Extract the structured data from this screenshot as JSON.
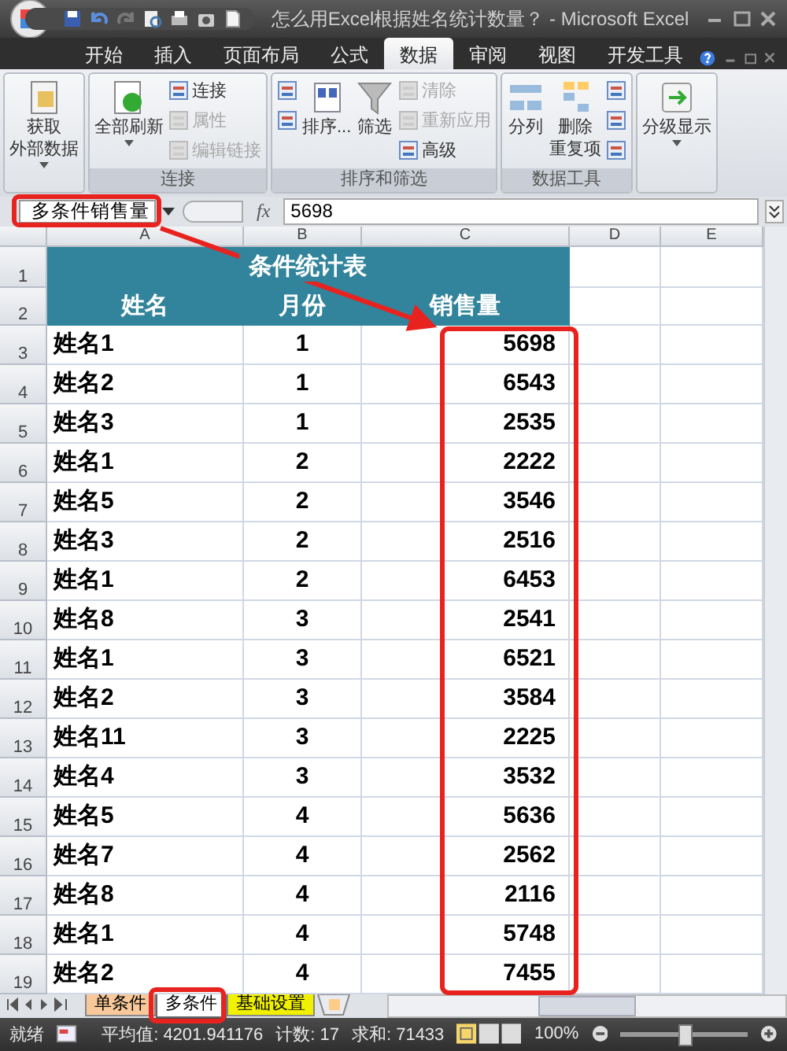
{
  "window": {
    "title": "怎么用Excel根据姓名统计数量？ - Microsoft Excel"
  },
  "ribbon_tabs": [
    {
      "label": "开始",
      "selected": false
    },
    {
      "label": "插入",
      "selected": false
    },
    {
      "label": "页面布局",
      "selected": false
    },
    {
      "label": "公式",
      "selected": false
    },
    {
      "label": "数据",
      "selected": true
    },
    {
      "label": "审阅",
      "selected": false
    },
    {
      "label": "视图",
      "selected": false
    },
    {
      "label": "开发工具",
      "selected": false
    }
  ],
  "ribbon_groups": [
    {
      "columns": [
        {
          "kind": "large",
          "label": [
            "获取",
            "外部数据"
          ],
          "dropdown": true
        }
      ]
    },
    {
      "label": "连接",
      "columns": [
        {
          "kind": "large",
          "label": [
            "全部刷新"
          ],
          "dropdown": true
        },
        {
          "kind": "stack",
          "buttons": [
            {
              "label": "连接",
              "disabled": false
            },
            {
              "label": "属性",
              "disabled": true
            },
            {
              "label": "编辑链接",
              "disabled": true
            }
          ]
        }
      ]
    },
    {
      "label": "排序和筛选",
      "columns": [
        {
          "kind": "stack",
          "buttons": [
            {
              "disabled": false
            },
            {
              "disabled": false
            }
          ]
        },
        {
          "kind": "large",
          "label": [
            "排序..."
          ],
          "dropdown": false
        },
        {
          "kind": "large",
          "label": [
            "筛选"
          ],
          "dropdown": false
        },
        {
          "kind": "stack",
          "buttons": [
            {
              "label": "清除",
              "disabled": true
            },
            {
              "label": "重新应用",
              "disabled": true
            },
            {
              "label": "高级",
              "disabled": false
            }
          ]
        }
      ]
    },
    {
      "label": "数据工具",
      "columns": [
        {
          "kind": "large",
          "label": [
            "分列"
          ],
          "dropdown": false
        },
        {
          "kind": "large",
          "label": [
            "删除",
            "重复项"
          ],
          "dropdown": false
        },
        {
          "kind": "stack",
          "buttons": [
            {
              "disabled": false
            },
            {
              "disabled": false
            },
            {
              "disabled": false
            }
          ]
        }
      ]
    },
    {
      "columns": [
        {
          "kind": "large",
          "label": [
            "分级显示"
          ],
          "dropdown": true
        }
      ]
    }
  ],
  "formula_bar": {
    "name_box": "多条件销售量",
    "function_label": "fx",
    "value": "5698"
  },
  "sheet": {
    "columns": [
      "A",
      "B",
      "C",
      "D",
      "E"
    ],
    "row_numbers": [
      "1",
      "2",
      "3",
      "4",
      "5",
      "6",
      "7",
      "8",
      "9",
      "10",
      "11",
      "12",
      "13",
      "14",
      "15",
      "16",
      "17",
      "18",
      "19"
    ],
    "title": "条件统计表",
    "headers": [
      "姓名",
      "月份",
      "销售量"
    ],
    "rows": [
      [
        "姓名1",
        "1",
        "5698"
      ],
      [
        "姓名2",
        "1",
        "6543"
      ],
      [
        "姓名3",
        "1",
        "2535"
      ],
      [
        "姓名1",
        "2",
        "2222"
      ],
      [
        "姓名5",
        "2",
        "3546"
      ],
      [
        "姓名3",
        "2",
        "2516"
      ],
      [
        "姓名1",
        "2",
        "6453"
      ],
      [
        "姓名8",
        "3",
        "2541"
      ],
      [
        "姓名1",
        "3",
        "6521"
      ],
      [
        "姓名2",
        "3",
        "3584"
      ],
      [
        "姓名11",
        "3",
        "2225"
      ],
      [
        "姓名4",
        "3",
        "3532"
      ],
      [
        "姓名5",
        "4",
        "5636"
      ],
      [
        "姓名7",
        "4",
        "2562"
      ],
      [
        "姓名8",
        "4",
        "2116"
      ],
      [
        "姓名1",
        "4",
        "5748"
      ],
      [
        "姓名2",
        "4",
        "7455"
      ]
    ]
  },
  "sheet_tabs": [
    {
      "label": "单条件",
      "selected": false,
      "color": "#f8c89a"
    },
    {
      "label": "多条件",
      "selected": true,
      "color": "#ffffff"
    },
    {
      "label": "基础设置",
      "selected": false,
      "color": "#f0f000"
    }
  ],
  "status_bar": {
    "mode": "就绪",
    "average": "平均值: 4201.941176",
    "count": "计数: 17",
    "sum": "求和: 71433",
    "zoom": "100%",
    "zoom_slider": {
      "level": 0.5
    }
  }
}
